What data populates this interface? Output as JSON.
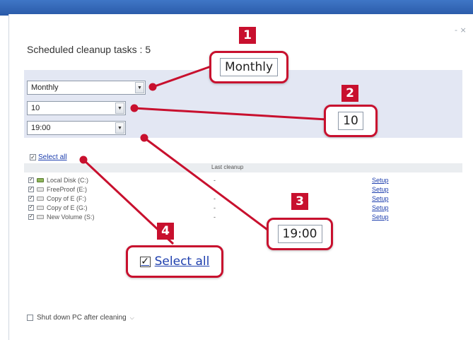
{
  "window": {
    "close_label": "- ×"
  },
  "scheduler": {
    "title": "Scheduled cleanup tasks : 5",
    "frequency": "Monthly",
    "day": "10",
    "time": "19:00"
  },
  "select_all_label": "Select all",
  "table": {
    "col_last_cleanup": "Last cleanup",
    "rows": [
      {
        "name": "Local Disk (C:)",
        "last": "-",
        "setup": "Setup"
      },
      {
        "name": "FreeProof (E:)",
        "last": "-",
        "setup": "Setup"
      },
      {
        "name": "Copy of E (F:)",
        "last": "-",
        "setup": "Setup"
      },
      {
        "name": "Copy of E (G:)",
        "last": "-",
        "setup": "Setup"
      },
      {
        "name": "New Volume (S:)",
        "last": "-",
        "setup": "Setup"
      }
    ]
  },
  "shutdown_label": "Shut down PC after cleaning",
  "callouts": {
    "c1": {
      "num": "1",
      "text": "Monthly"
    },
    "c2": {
      "num": "2",
      "text": "10"
    },
    "c3": {
      "num": "3",
      "text": "19:00"
    },
    "c4": {
      "num": "4",
      "text": "Select all"
    }
  },
  "colors": {
    "callout_red": "#c8102e",
    "link_blue": "#1e3fae",
    "band": "#e3e7f3"
  }
}
